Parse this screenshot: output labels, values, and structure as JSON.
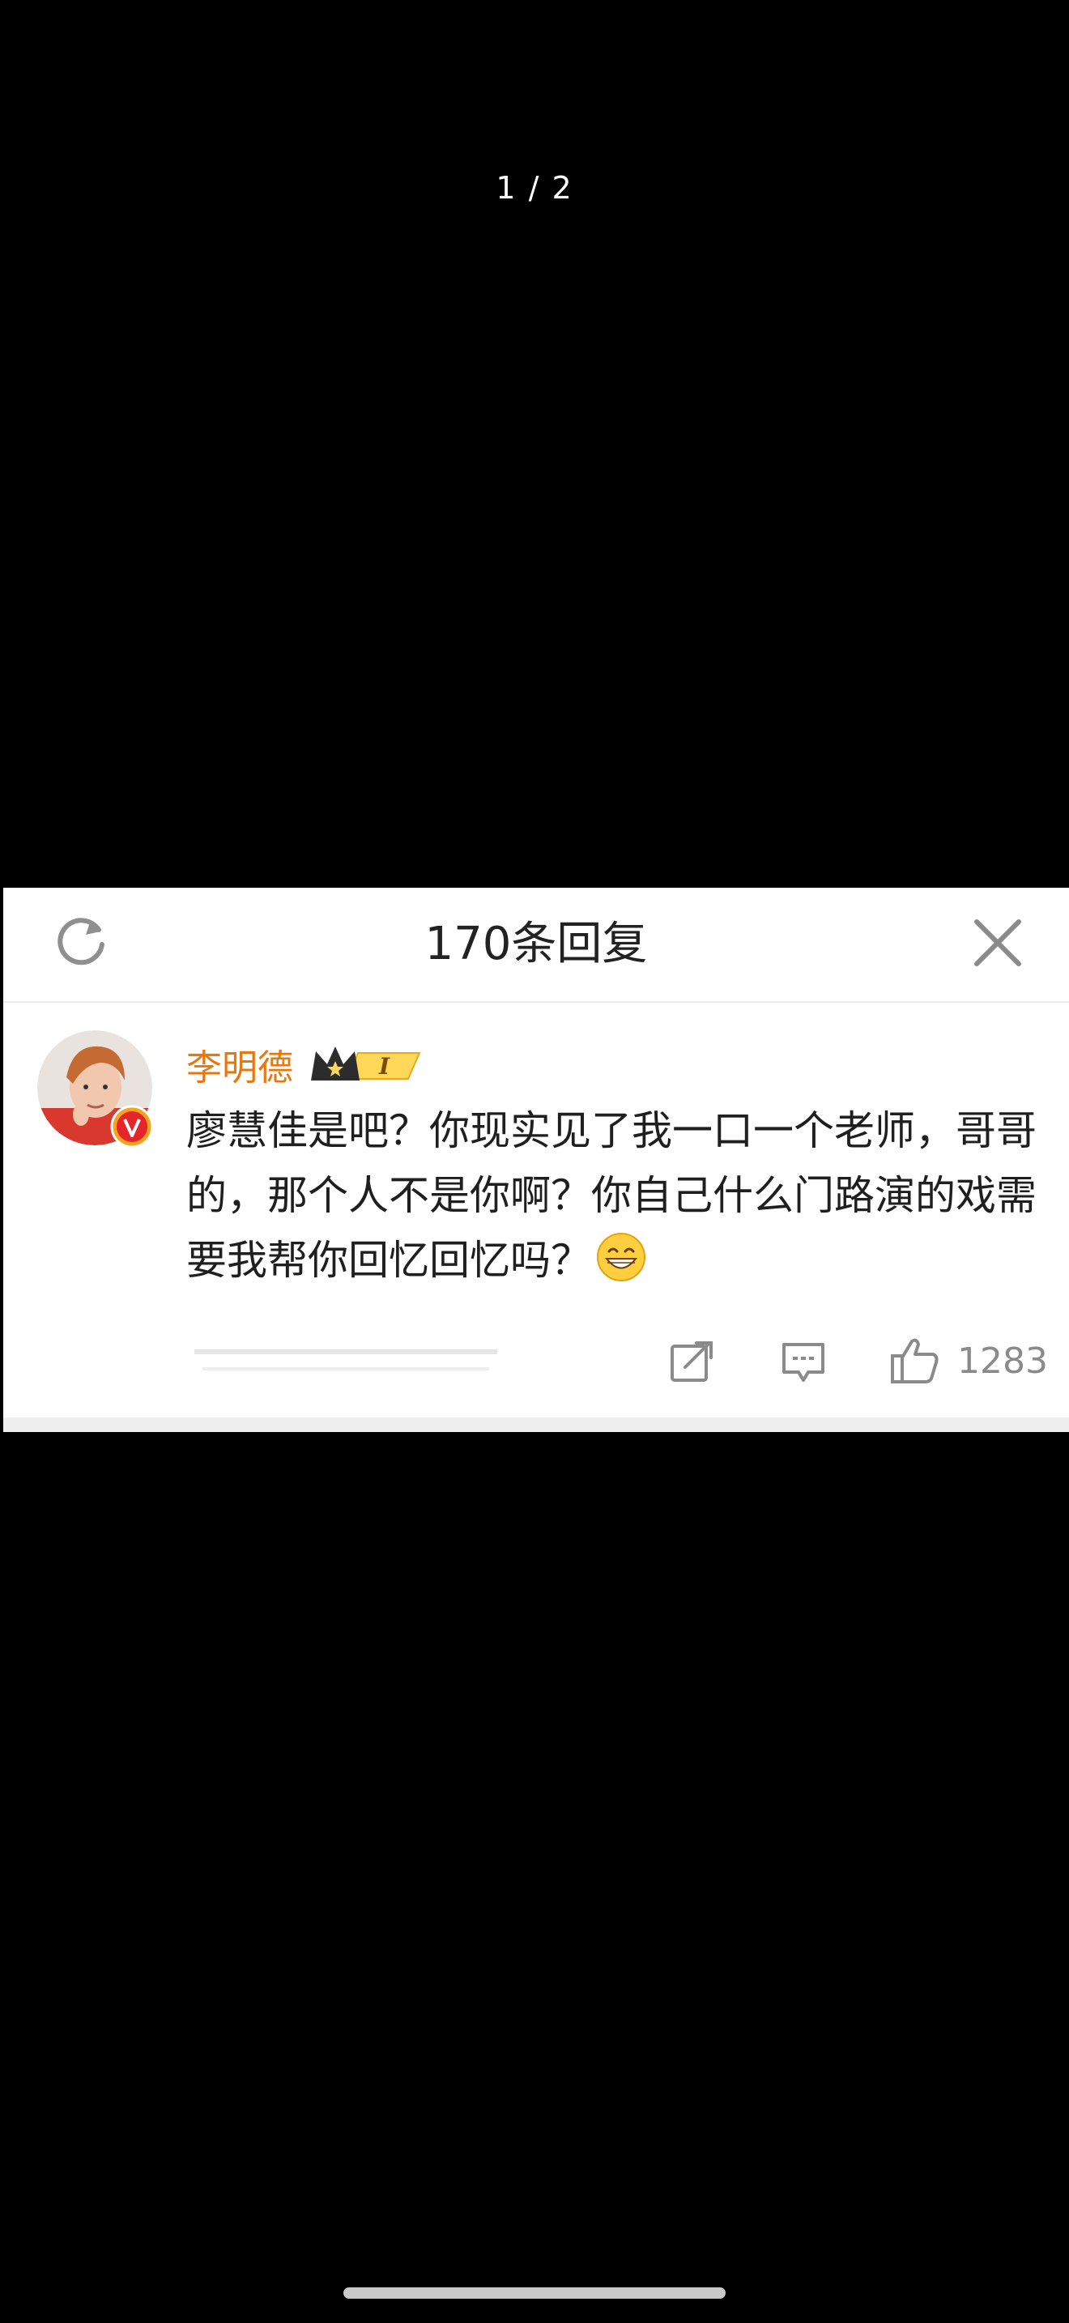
{
  "viewer": {
    "page_indicator": "1 / 2"
  },
  "card": {
    "title": "170条回复",
    "icons": {
      "refresh": "refresh-icon",
      "close": "close-icon"
    }
  },
  "comment": {
    "username": "李明德",
    "avatar": "avatar",
    "verified": "verified-badge",
    "level_badge": "crown-level-badge",
    "level_text": "I",
    "text": "廖慧佳是吧？你现实见了我一口一个老师，哥哥的，那个人不是你啊？你自己什么门路演的戏需要我帮你回忆回忆吗？",
    "emoji": "grin-emoji",
    "likes": "1283",
    "actions": {
      "share": "share-icon",
      "reply": "comment-icon",
      "like": "thumbs-up-icon"
    }
  },
  "colors": {
    "background": "#000000",
    "card": "#ffffff",
    "username": "#e8770e",
    "text": "#1f1f1f",
    "muted": "#8a8a8a"
  }
}
